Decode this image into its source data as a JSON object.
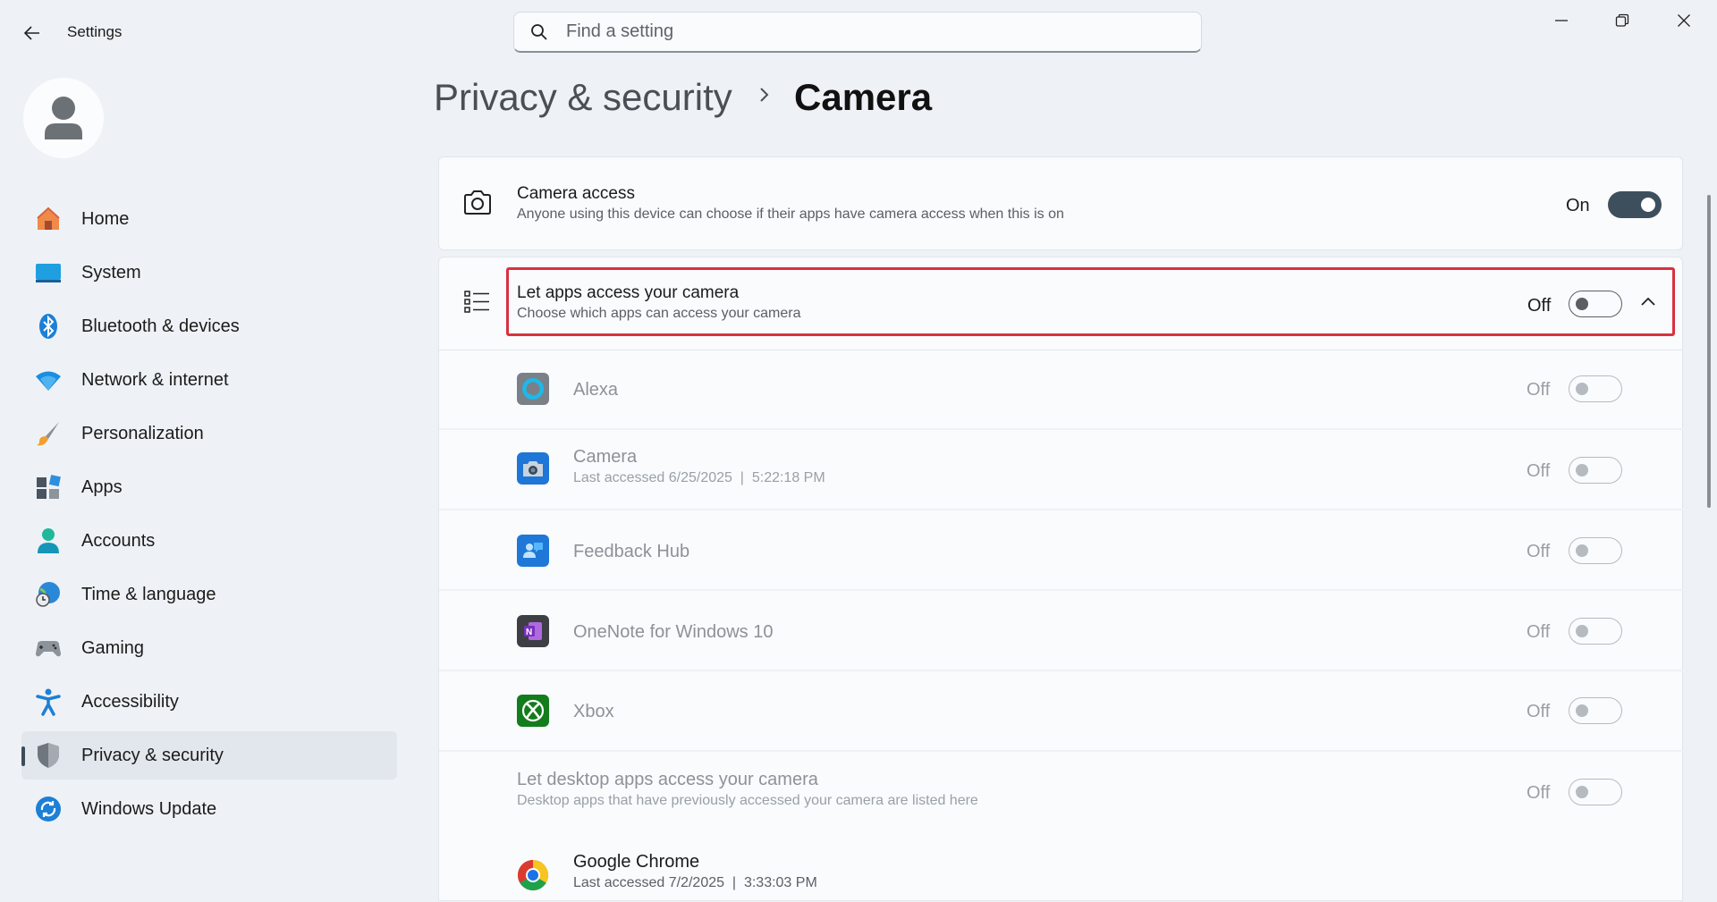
{
  "app": {
    "title": "Settings"
  },
  "search": {
    "placeholder": "Find a setting"
  },
  "breadcrumb": {
    "parent": "Privacy & security",
    "current": "Camera"
  },
  "sidebar": {
    "items": [
      {
        "label": "Home",
        "icon": "home-icon"
      },
      {
        "label": "System",
        "icon": "system-icon"
      },
      {
        "label": "Bluetooth & devices",
        "icon": "bluetooth-icon"
      },
      {
        "label": "Network & internet",
        "icon": "wifi-icon"
      },
      {
        "label": "Personalization",
        "icon": "brush-icon"
      },
      {
        "label": "Apps",
        "icon": "apps-icon"
      },
      {
        "label": "Accounts",
        "icon": "accounts-icon"
      },
      {
        "label": "Time & language",
        "icon": "globe-clock-icon"
      },
      {
        "label": "Gaming",
        "icon": "gamepad-icon"
      },
      {
        "label": "Accessibility",
        "icon": "accessibility-icon"
      },
      {
        "label": "Privacy & security",
        "icon": "shield-icon",
        "active": true
      },
      {
        "label": "Windows Update",
        "icon": "update-icon"
      }
    ]
  },
  "camera_access": {
    "title": "Camera access",
    "description": "Anyone using this device can choose if their apps have camera access when this is on",
    "state": "On"
  },
  "let_apps": {
    "title": "Let apps access your camera",
    "description": "Choose which apps can access your camera",
    "state": "Off"
  },
  "apps": [
    {
      "name": "Alexa",
      "detail": "",
      "state": "Off",
      "icon": "alexa-icon"
    },
    {
      "name": "Camera",
      "detail": "Last accessed 6/25/2025  |  5:22:18 PM",
      "state": "Off",
      "icon": "camera-app-icon"
    },
    {
      "name": "Feedback Hub",
      "detail": "",
      "state": "Off",
      "icon": "feedback-hub-icon"
    },
    {
      "name": "OneNote for Windows 10",
      "detail": "",
      "state": "Off",
      "icon": "onenote-icon"
    },
    {
      "name": "Xbox",
      "detail": "",
      "state": "Off",
      "icon": "xbox-icon"
    }
  ],
  "desktop_apps": {
    "title": "Let desktop apps access your camera",
    "description": "Desktop apps that have previously accessed your camera are listed here",
    "state": "Off"
  },
  "chrome": {
    "name": "Google Chrome",
    "detail": "Last accessed 7/2/2025  |  3:33:03 PM",
    "icon": "chrome-icon"
  },
  "colors": {
    "accent": "#3d4f5d",
    "highlight": "#d8313f",
    "background": "#eef2f6"
  }
}
